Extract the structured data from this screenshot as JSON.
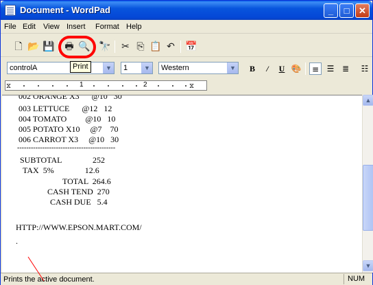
{
  "window": {
    "title": "Document - WordPad"
  },
  "titlebar": {
    "min": "_",
    "max": "□",
    "close": "✕"
  },
  "menu": [
    "File",
    "Edit",
    "View",
    "Insert",
    "Format",
    "Help"
  ],
  "toolbar": {
    "icons": [
      "new-icon",
      "open-icon",
      "save-icon",
      "print-icon",
      "print-preview-icon",
      "find-icon",
      "cut-icon",
      "copy-icon",
      "paste-icon",
      "undo-icon",
      "insert-datetime-icon"
    ],
    "tooltip": "Print"
  },
  "format": {
    "font": "controlA",
    "size": "1",
    "script": "Western",
    "bold": "B",
    "italic": "/",
    "underline": "U"
  },
  "ruler": {
    "marks": [
      "1",
      "2"
    ]
  },
  "document": {
    "lines": [
      "002 ORANGE X3      @10   30",
      "003 LETTUCE      @12   12",
      "004 TOMATO         @10   10",
      "005 POTATO X10     @7    70",
      "006 CARROT X3     @10   30",
      "-------------------------------------------",
      "SUBTOTAL               252",
      "TAX  5%               12.6",
      "TOTAL  264.6",
      "CASH TEND  270",
      "CASH DUE   5.4",
      "HTTP://WWW.EPSON.MART.COM/",
      "."
    ]
  },
  "status": {
    "text": "Prints the active document.",
    "num": "NUM"
  },
  "colors": {
    "highlight": "#ff0000",
    "titlebar": "#0a5fe8"
  }
}
